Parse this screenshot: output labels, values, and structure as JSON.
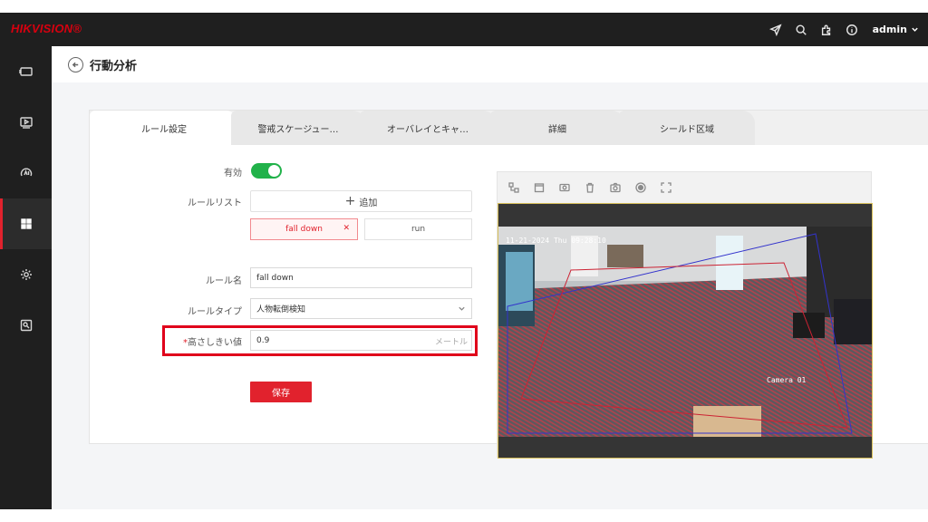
{
  "app": {
    "brand": "HIKVISION®",
    "user": "admin"
  },
  "topbar_icons": [
    "send-icon",
    "search-icon",
    "puzzle-icon",
    "info-icon"
  ],
  "sidebar": {
    "items": [
      {
        "name": "live-view",
        "icon": "monitor-icon"
      },
      {
        "name": "playback",
        "icon": "play-icon"
      },
      {
        "name": "ai",
        "icon": "ai-icon"
      },
      {
        "name": "apps",
        "icon": "grid-icon",
        "active": true
      },
      {
        "name": "settings",
        "icon": "gear-icon"
      },
      {
        "name": "picture",
        "icon": "image-icon"
      }
    ]
  },
  "page": {
    "title": "行動分析"
  },
  "tabs": [
    {
      "label": "ルール設定",
      "active": true
    },
    {
      "label": "警戒スケージュー…"
    },
    {
      "label": "オーバレイとキャ…"
    },
    {
      "label": "詳細"
    },
    {
      "label": "シールド区域"
    }
  ],
  "form": {
    "enabled_label": "有効",
    "enabled": true,
    "rule_list_label": "ルールリスト",
    "add_label": "追加",
    "rules": [
      {
        "name": "fall down",
        "selected": true
      },
      {
        "name": "run",
        "selected": false
      }
    ],
    "rule_name_label": "ルール名",
    "rule_name_value": "fall down",
    "rule_type_label": "ルールタイプ",
    "rule_type_value": "人物転倒検知",
    "height_label": "高さしきい値",
    "height_required_mark": "*",
    "height_value": "0.9",
    "height_unit": "メートル",
    "save_label": "保存"
  },
  "video": {
    "toolbar": [
      "region-icon",
      "clear-icon",
      "draw-icon",
      "delete-icon",
      "snapshot-icon",
      "record-icon",
      "fullscreen-icon"
    ],
    "osd_datetime": "11-21-2024 Thu 09:28:10",
    "osd_camera": "Camera 01"
  },
  "colors": {
    "accent": "#e1222d",
    "toggle_on": "#21b24a",
    "highlight_box": "#e0001b"
  }
}
